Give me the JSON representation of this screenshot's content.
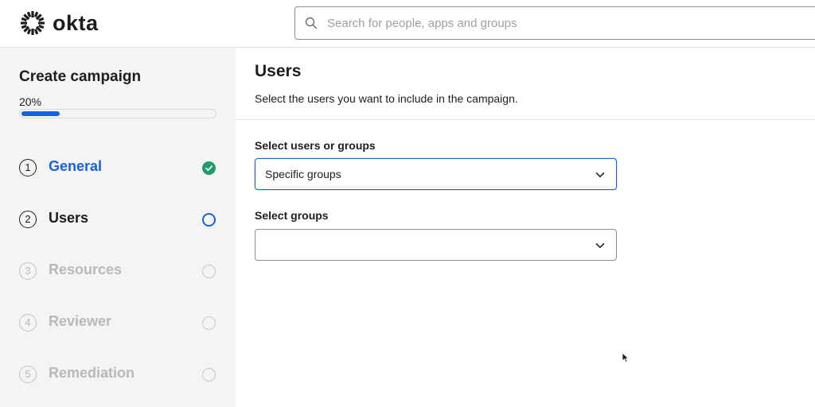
{
  "header": {
    "brand": "okta",
    "search_placeholder": "Search for people, apps and groups",
    "search_value": ""
  },
  "sidebar": {
    "title": "Create campaign",
    "progress_label": "20%",
    "progress_fraction": 0.2,
    "steps": [
      {
        "number": "1",
        "label": "General",
        "status": "complete"
      },
      {
        "number": "2",
        "label": "Users",
        "status": "current"
      },
      {
        "number": "3",
        "label": "Resources",
        "status": "pending"
      },
      {
        "number": "4",
        "label": "Reviewer",
        "status": "pending"
      },
      {
        "number": "5",
        "label": "Remediation",
        "status": "pending"
      }
    ]
  },
  "main": {
    "title": "Users",
    "subtitle": "Select the users you want to include in the campaign.",
    "users_field": {
      "label": "Select users or groups",
      "value": "Specific groups"
    },
    "groups_field": {
      "label": "Select groups",
      "value": ""
    }
  },
  "colors": {
    "accent": "#1662dd",
    "success": "#1e9c6b",
    "sidebar_bg": "#f4f4f4",
    "disabled_text": "#b8b8bd"
  },
  "icons": {
    "logo": "okta-sunburst-icon",
    "search": "search-icon",
    "dropdown": "chevron-down-icon",
    "done": "check-circle-icon"
  }
}
